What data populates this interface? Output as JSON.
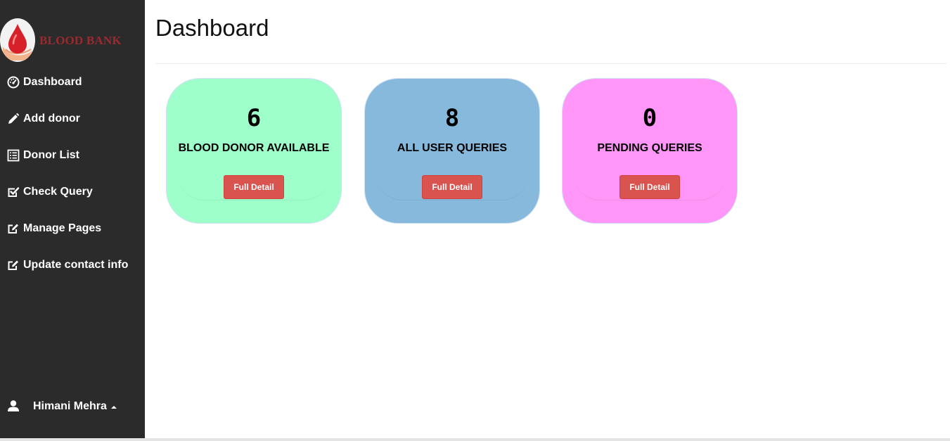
{
  "brand": {
    "logo_text": "BLOOD BANK",
    "accent": "#9b2a2f"
  },
  "sidebar": {
    "items": [
      {
        "label": "Dashboard",
        "icon": "dashboard-icon"
      },
      {
        "label": "Add donor",
        "icon": "pencil-icon"
      },
      {
        "label": "Donor List",
        "icon": "list-icon"
      },
      {
        "label": "Check Query",
        "icon": "check-square-icon"
      },
      {
        "label": "Manage Pages",
        "icon": "edit-square-icon"
      },
      {
        "label": "Update contact info",
        "icon": "edit-square-icon"
      }
    ],
    "user": {
      "name": "Himani Mehra",
      "icon": "user-icon"
    }
  },
  "main": {
    "title": "Dashboard",
    "cards": [
      {
        "value": "6",
        "label": "BLOOD DONOR AVAILABLE",
        "button": "Full Detail",
        "color": "#9fffcb"
      },
      {
        "value": "8",
        "label": "ALL USER QUERIES",
        "button": "Full Detail",
        "color": "#87b9dc"
      },
      {
        "value": "0",
        "label": "PENDING QUERIES",
        "button": "Full Detail",
        "color": "#ff96f8"
      }
    ]
  },
  "colors": {
    "sidebar_bg": "#2b2b2b",
    "button_bg": "#d9534f"
  }
}
